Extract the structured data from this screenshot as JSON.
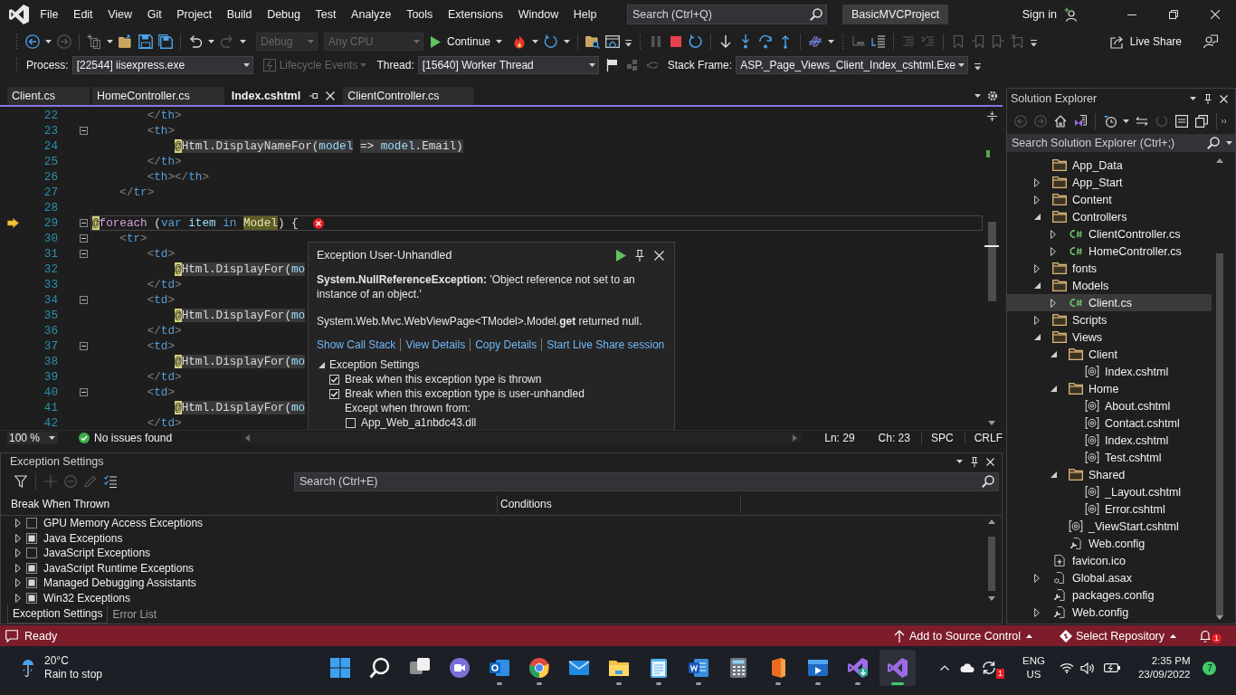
{
  "window": {
    "title": "BasicMVCProject",
    "search_placeholder": "Search (Ctrl+Q)",
    "sign_in": "Sign in"
  },
  "menu": [
    "File",
    "Edit",
    "View",
    "Git",
    "Project",
    "Build",
    "Debug",
    "Test",
    "Analyze",
    "Tools",
    "Extensions",
    "Window",
    "Help"
  ],
  "toolbar": {
    "configurations": [
      {
        "value": "Debug",
        "disabled": true
      },
      {
        "value": "Any CPU",
        "disabled": true
      }
    ],
    "continue": "Continue",
    "live_share": "Live Share"
  },
  "debug_location": {
    "process_label": "Process:",
    "process": "[22544] iisexpress.exe",
    "lifecycle": {
      "label": "Lifecycle Events",
      "disabled": true
    },
    "thread_label": "Thread:",
    "thread": "[15640] Worker Thread",
    "stack_frame_label": "Stack Frame:",
    "stack_frame": "ASP._Page_Views_Client_Index_cshtml.Exe"
  },
  "editor_tabs": [
    {
      "label": "Client.cs",
      "selected": false
    },
    {
      "label": "HomeController.cs",
      "selected": false
    },
    {
      "label": "Index.cshtml",
      "selected": true
    },
    {
      "label": "ClientController.cs",
      "selected": false
    }
  ],
  "code": {
    "lines": [
      {
        "number": "22",
        "fold": false,
        "current": false,
        "tokens": [
          {
            "text": "        </",
            "kind": "punct"
          },
          {
            "text": "th",
            "kind": "tag"
          },
          {
            "text": ">",
            "kind": "punct"
          }
        ]
      },
      {
        "number": "23",
        "fold": true,
        "current": false,
        "tokens": [
          {
            "text": "        <",
            "kind": "punct"
          },
          {
            "text": "th",
            "kind": "tag"
          },
          {
            "text": ">",
            "kind": "punct"
          }
        ]
      },
      {
        "number": "24",
        "fold": false,
        "current": false,
        "tokens": [
          {
            "text": "            @",
            "kind": "transition"
          },
          {
            "text": "Html.DisplayNameFor(",
            "kind": "expr"
          },
          {
            "text": "model",
            "kind": "param"
          },
          {
            "text": " => ",
            "kind": "expr"
          },
          {
            "text": "model",
            "kind": "param"
          },
          {
            "text": ".Email)",
            "kind": "expr"
          }
        ]
      },
      {
        "number": "25",
        "fold": false,
        "current": false,
        "tokens": [
          {
            "text": "        </",
            "kind": "punct"
          },
          {
            "text": "th",
            "kind": "tag"
          },
          {
            "text": ">",
            "kind": "punct"
          }
        ]
      },
      {
        "number": "26",
        "fold": false,
        "current": false,
        "tokens": [
          {
            "text": "        <",
            "kind": "punct"
          },
          {
            "text": "th",
            "kind": "tag"
          },
          {
            "text": "></",
            "kind": "punct"
          },
          {
            "text": "th",
            "kind": "tag"
          },
          {
            "text": ">",
            "kind": "punct"
          }
        ]
      },
      {
        "number": "27",
        "fold": false,
        "current": false,
        "tokens": [
          {
            "text": "    </",
            "kind": "punct"
          },
          {
            "text": "tr",
            "kind": "tag"
          },
          {
            "text": ">",
            "kind": "punct"
          }
        ]
      },
      {
        "number": "28",
        "fold": false,
        "current": false
      },
      {
        "number": "29",
        "fold": true,
        "current": true,
        "tokens": [
          {
            "text": "@",
            "kind": "transition"
          },
          {
            "text": "foreach",
            "kind": "control"
          },
          {
            "text": " (",
            "kind": "plain"
          },
          {
            "text": "var",
            "kind": "keyword"
          },
          {
            "text": " item",
            "kind": "variable"
          },
          {
            "text": " in",
            "kind": "keyword"
          },
          {
            "text": " Model",
            "kind": "reference"
          },
          {
            "text": ") {",
            "kind": "plain"
          }
        ]
      },
      {
        "number": "30",
        "fold": true,
        "current": false,
        "tokens": [
          {
            "text": "    <",
            "kind": "punct"
          },
          {
            "text": "tr",
            "kind": "tag"
          },
          {
            "text": ">",
            "kind": "punct"
          }
        ]
      },
      {
        "number": "31",
        "fold": true,
        "current": false,
        "tokens": [
          {
            "text": "        <",
            "kind": "punct"
          },
          {
            "text": "td",
            "kind": "tag"
          },
          {
            "text": ">",
            "kind": "punct"
          }
        ]
      },
      {
        "number": "32",
        "fold": false,
        "current": false,
        "tokens": [
          {
            "text": "            @",
            "kind": "transition"
          },
          {
            "text": "Html.DisplayFor(",
            "kind": "expr"
          },
          {
            "text": "mo",
            "kind": "param"
          }
        ]
      },
      {
        "number": "33",
        "fold": false,
        "current": false,
        "tokens": [
          {
            "text": "        </",
            "kind": "punct"
          },
          {
            "text": "td",
            "kind": "tag"
          },
          {
            "text": ">",
            "kind": "punct"
          }
        ]
      },
      {
        "number": "34",
        "fold": true,
        "current": false,
        "tokens": [
          {
            "text": "        <",
            "kind": "punct"
          },
          {
            "text": "td",
            "kind": "tag"
          },
          {
            "text": ">",
            "kind": "punct"
          }
        ]
      },
      {
        "number": "35",
        "fold": false,
        "current": false,
        "tokens": [
          {
            "text": "            @",
            "kind": "transition"
          },
          {
            "text": "Html.DisplayFor(",
            "kind": "expr"
          },
          {
            "text": "mo",
            "kind": "param"
          }
        ]
      },
      {
        "number": "36",
        "fold": false,
        "current": false,
        "tokens": [
          {
            "text": "        </",
            "kind": "punct"
          },
          {
            "text": "td",
            "kind": "tag"
          },
          {
            "text": ">",
            "kind": "punct"
          }
        ]
      },
      {
        "number": "37",
        "fold": true,
        "current": false,
        "tokens": [
          {
            "text": "        <",
            "kind": "punct"
          },
          {
            "text": "td",
            "kind": "tag"
          },
          {
            "text": ">",
            "kind": "punct"
          }
        ]
      },
      {
        "number": "38",
        "fold": false,
        "current": false,
        "tokens": [
          {
            "text": "            @",
            "kind": "transition"
          },
          {
            "text": "Html.DisplayFor(",
            "kind": "expr"
          },
          {
            "text": "mo",
            "kind": "param"
          }
        ]
      },
      {
        "number": "39",
        "fold": false,
        "current": false,
        "tokens": [
          {
            "text": "        </",
            "kind": "punct"
          },
          {
            "text": "td",
            "kind": "tag"
          },
          {
            "text": ">",
            "kind": "punct"
          }
        ]
      },
      {
        "number": "40",
        "fold": true,
        "current": false,
        "tokens": [
          {
            "text": "        <",
            "kind": "punct"
          },
          {
            "text": "td",
            "kind": "tag"
          },
          {
            "text": ">",
            "kind": "punct"
          }
        ]
      },
      {
        "number": "41",
        "fold": false,
        "current": false,
        "tokens": [
          {
            "text": "            @",
            "kind": "transition"
          },
          {
            "text": "Html.DisplayFor(",
            "kind": "expr"
          },
          {
            "text": "mo",
            "kind": "param"
          }
        ]
      },
      {
        "number": "42",
        "fold": false,
        "current": false,
        "tokens": [
          {
            "text": "        </",
            "kind": "punct"
          },
          {
            "text": "td",
            "kind": "tag"
          },
          {
            "text": ">",
            "kind": "punct"
          }
        ]
      }
    ]
  },
  "exception": {
    "title": "Exception User-Unhandled",
    "message": "**System.NullReferenceException:** 'Object reference not set to an instance of an object.'",
    "detail": "System.Web.Mvc.WebViewPage<TModel>.Model.**get** returned null.",
    "links": [
      "Show Call Stack",
      "View Details",
      "Copy Details",
      "Start Live Share session"
    ],
    "settings": {
      "label": "Exception Settings",
      "expanded": true,
      "options": [
        {
          "label": "Break when this exception type is thrown",
          "checked": true
        },
        {
          "label": "Break when this exception type is user-unhandled",
          "checked": true
        }
      ],
      "except_label": "Except when thrown from:",
      "modules": [
        {
          "label": "App_Web_a1nbdc43.dll",
          "checked": false
        }
      ]
    }
  },
  "editor_status": {
    "zoom": "100 %",
    "issues": "No issues found",
    "line": "Ln: 29",
    "column": "Ch: 23",
    "indentation": "SPC",
    "line_ending": "CRLF"
  },
  "exception_panel": {
    "title": "Exception Settings",
    "search_placeholder": "Search (Ctrl+E)",
    "columns": [
      "Break When Thrown",
      "Conditions"
    ],
    "rows": [
      {
        "label": "GPU Memory Access Exceptions",
        "partial": false
      },
      {
        "label": "Java Exceptions",
        "partial": true
      },
      {
        "label": "JavaScript Exceptions",
        "partial": false
      },
      {
        "label": "JavaScript Runtime Exceptions",
        "partial": true
      },
      {
        "label": "Managed Debugging Assistants",
        "partial": true
      },
      {
        "label": "Win32 Exceptions",
        "partial": true
      }
    ],
    "tabs": [
      {
        "label": "Exception Settings",
        "selected": true
      },
      {
        "label": "Error List",
        "selected": false
      }
    ]
  },
  "solution_explorer": {
    "title": "Solution Explorer",
    "search_placeholder": "Search Solution Explorer (Ctrl+;)",
    "items": [
      {
        "label": "App_Data",
        "kind": "folder",
        "selected": false
      },
      {
        "label": "App_Start",
        "kind": "folder",
        "expanded": false,
        "selected": false
      },
      {
        "label": "Content",
        "kind": "folder",
        "expanded": false,
        "selected": false
      },
      {
        "label": "Controllers",
        "kind": "folder",
        "expanded": true,
        "selected": false,
        "children": [
          {
            "label": "ClientController.cs",
            "kind": "csharp",
            "expanded": false,
            "selected": false
          },
          {
            "label": "HomeController.cs",
            "kind": "csharp",
            "expanded": false,
            "selected": false
          }
        ]
      },
      {
        "label": "fonts",
        "kind": "folder",
        "expanded": false,
        "selected": false
      },
      {
        "label": "Models",
        "kind": "folder",
        "expanded": true,
        "selected": false,
        "children": [
          {
            "label": "Client.cs",
            "kind": "csharp",
            "expanded": false,
            "selected": true
          }
        ]
      },
      {
        "label": "Scripts",
        "kind": "folder",
        "expanded": false,
        "selected": false
      },
      {
        "label": "Views",
        "kind": "folder",
        "expanded": true,
        "selected": false,
        "children": [
          {
            "label": "Client",
            "kind": "folder",
            "expanded": true,
            "selected": false,
            "children": [
              {
                "label": "Index.cshtml",
                "kind": "razor",
                "selected": false
              }
            ]
          },
          {
            "label": "Home",
            "kind": "folder",
            "expanded": true,
            "selected": false,
            "children": [
              {
                "label": "About.cshtml",
                "kind": "razor",
                "selected": false
              },
              {
                "label": "Contact.cshtml",
                "kind": "razor",
                "selected": false
              },
              {
                "label": "Index.cshtml",
                "kind": "razor",
                "selected": false
              },
              {
                "label": "Test.cshtml",
                "kind": "razor",
                "selected": false
              }
            ]
          },
          {
            "label": "Shared",
            "kind": "folder",
            "expanded": true,
            "selected": false,
            "children": [
              {
                "label": "_Layout.cshtml",
                "kind": "razor",
                "selected": false
              },
              {
                "label": "Error.cshtml",
                "kind": "razor",
                "selected": false
              }
            ]
          },
          {
            "label": "_ViewStart.cshtml",
            "kind": "razor",
            "selected": false
          },
          {
            "label": "Web.config",
            "kind": "config",
            "selected": false
          }
        ]
      },
      {
        "label": "favicon.ico",
        "kind": "image",
        "selected": false
      },
      {
        "label": "Global.asax",
        "kind": "asax",
        "expanded": false,
        "selected": false
      },
      {
        "label": "packages.config",
        "kind": "config",
        "selected": false
      },
      {
        "label": "Web.config",
        "kind": "config",
        "expanded": false,
        "selected": false
      }
    ]
  },
  "status_bar": {
    "message": "Ready",
    "source_control": "Add to Source Control",
    "repository": "Select Repository",
    "notifications": "1"
  },
  "taskbar": {
    "weather": {
      "temperature": "20°C",
      "condition": "Rain to stop"
    },
    "apps": [
      {
        "kind": "start",
        "running": false,
        "active": false
      },
      {
        "kind": "search",
        "running": false,
        "active": false
      },
      {
        "kind": "taskview",
        "running": false,
        "active": false
      },
      {
        "kind": "chat",
        "running": false,
        "active": false
      },
      {
        "kind": "outlook",
        "running": true,
        "active": false
      },
      {
        "kind": "chrome",
        "running": true,
        "active": false
      },
      {
        "kind": "mail",
        "running": false,
        "active": false
      },
      {
        "kind": "explorer",
        "running": true,
        "active": false
      },
      {
        "kind": "notepad",
        "running": true,
        "active": false
      },
      {
        "kind": "word",
        "running": true,
        "active": false
      },
      {
        "kind": "calculator",
        "running": false,
        "active": false
      },
      {
        "kind": "office",
        "running": true,
        "active": false
      },
      {
        "kind": "movies",
        "running": true,
        "active": false
      },
      {
        "kind": "vs_installer",
        "running": true,
        "active": false
      },
      {
        "kind": "vs",
        "running": true,
        "active": true
      }
    ],
    "tray": {
      "sync_badge": "1",
      "language": "ENG",
      "region": "US",
      "time": "2:35 PM",
      "date": "23/09/2022",
      "notifications": "7"
    }
  }
}
